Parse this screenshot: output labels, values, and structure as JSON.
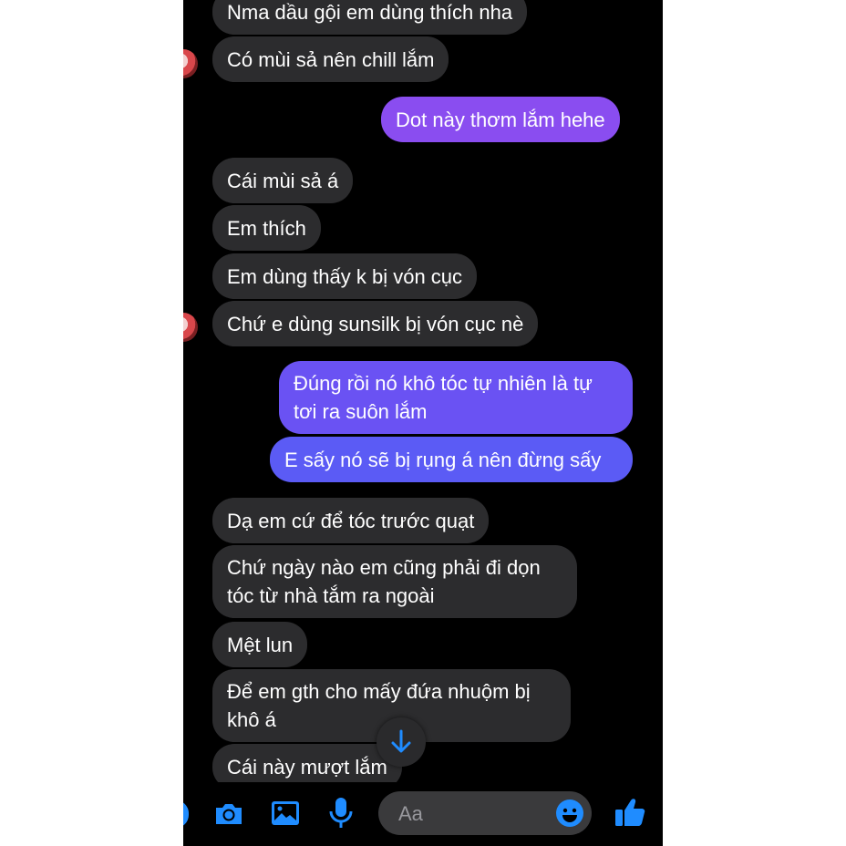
{
  "messages": [
    {
      "side": "in",
      "text": "Nma dầu gội em dùng thích nha"
    },
    {
      "side": "in",
      "text": "Có mùi sả nên chill lắm"
    },
    {
      "side": "out",
      "text": "Dot này thơm lắm hehe"
    },
    {
      "side": "in",
      "text": "Cái mùi sả á"
    },
    {
      "side": "in",
      "text": "Em thích"
    },
    {
      "side": "in",
      "text": "Em dùng thấy k bị vón cục"
    },
    {
      "side": "in",
      "text": "Chứ e dùng sunsilk bị vón cục nè"
    },
    {
      "side": "out",
      "text": "Đúng rồi nó khô tóc tự nhiên là tự tơi ra suôn lắm"
    },
    {
      "side": "out",
      "text": "E sấy nó sẽ bị rụng á nên đừng sấy"
    },
    {
      "side": "in",
      "text": "Dạ em cứ để tóc trước quạt"
    },
    {
      "side": "in",
      "text": "Chứ ngày nào em cũng phải đi dọn tóc từ nhà tắm ra ngoài"
    },
    {
      "side": "in",
      "text": "Mệt lun"
    },
    {
      "side": "in",
      "text": "Để em gth cho mấy đứa nhuộm bị khô á"
    },
    {
      "side": "in",
      "text": "Cái này mượt lắm"
    }
  ],
  "composer": {
    "placeholder": "Aa",
    "icons": [
      "camera-icon",
      "gallery-icon",
      "microphone-icon",
      "emoji-icon",
      "thumbs-up-icon"
    ]
  },
  "scroll_down_icon": "arrow-down-icon",
  "colors": {
    "background": "#000000",
    "incoming_bubble": "#2c2c2e",
    "outgoing_top": "#8a4df0",
    "outgoing_bottom": "#5b5bf5",
    "accent": "#1f8cff"
  }
}
